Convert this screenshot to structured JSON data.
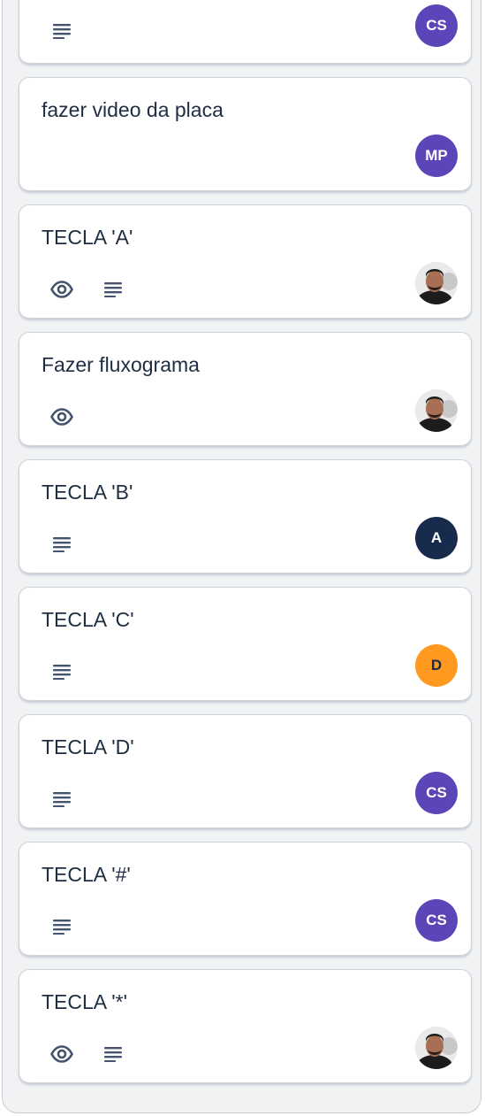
{
  "colors": {
    "avatar_cs": "#5b45b8",
    "avatar_mp": "#5b45b8",
    "avatar_a": "#172b4d",
    "avatar_d": "#ff991f",
    "avatar_d_text": "#172b4d"
  },
  "cards": [
    {
      "title": "",
      "icons": [
        "description-icon"
      ],
      "avatar": {
        "initials": "CS",
        "kind": "initials"
      }
    },
    {
      "title": "fazer video da placa",
      "icons": [],
      "avatar": {
        "initials": "MP",
        "kind": "initials"
      }
    },
    {
      "title": "TECLA 'A'",
      "icons": [
        "eye-icon",
        "description-icon"
      ],
      "avatar": {
        "kind": "photo"
      }
    },
    {
      "title": "Fazer fluxograma",
      "icons": [
        "eye-icon"
      ],
      "avatar": {
        "kind": "photo"
      }
    },
    {
      "title": "TECLA 'B'",
      "icons": [
        "description-icon"
      ],
      "avatar": {
        "initials": "A",
        "kind": "initials"
      }
    },
    {
      "title": "TECLA 'C'",
      "icons": [
        "description-icon"
      ],
      "avatar": {
        "initials": "D",
        "kind": "initials"
      }
    },
    {
      "title": "TECLA 'D'",
      "icons": [
        "description-icon"
      ],
      "avatar": {
        "initials": "CS",
        "kind": "initials"
      }
    },
    {
      "title": "TECLA '#'",
      "icons": [
        "description-icon"
      ],
      "avatar": {
        "initials": "CS",
        "kind": "initials"
      }
    },
    {
      "title": "TECLA '*'",
      "icons": [
        "eye-icon",
        "description-icon"
      ],
      "avatar": {
        "kind": "photo"
      }
    }
  ]
}
